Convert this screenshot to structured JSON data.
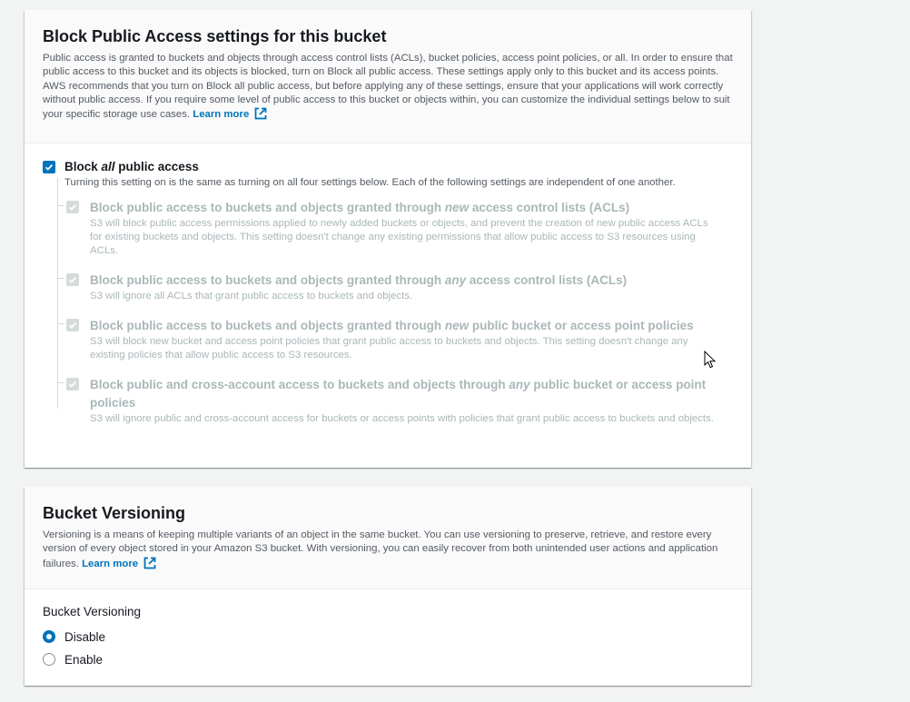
{
  "block_public_access": {
    "title": "Block Public Access settings for this bucket",
    "description": "Public access is granted to buckets and objects through access control lists (ACLs), bucket policies, access point policies, or all. In order to ensure that public access to this bucket and its objects is blocked, turn on Block all public access. These settings apply only to this bucket and its access points. AWS recommends that you turn on Block all public access, but before applying any of these settings, ensure that your applications will work correctly without public access. If you require some level of public access to this bucket or objects within, you can customize the individual settings below to suit your specific storage use cases.",
    "learn_more": "Learn more",
    "external_icon": "external-link-icon",
    "master": {
      "label_pre": "Block ",
      "label_em": "all",
      "label_post": " public access",
      "description": "Turning this setting on is the same as turning on all four settings below. Each of the following settings are independent of one another.",
      "checked": true
    },
    "settings": [
      {
        "label_pre": "Block public access to buckets and objects granted through ",
        "label_em": "new",
        "label_post": " access control lists (ACLs)",
        "description": "S3 will block public access permissions applied to newly added buckets or objects, and prevent the creation of new public access ACLs for existing buckets and objects. This setting doesn't change any existing permissions that allow public access to S3 resources using ACLs.",
        "checked": true,
        "disabled": true
      },
      {
        "label_pre": "Block public access to buckets and objects granted through ",
        "label_em": "any",
        "label_post": " access control lists (ACLs)",
        "description": "S3 will ignore all ACLs that grant public access to buckets and objects.",
        "checked": true,
        "disabled": true
      },
      {
        "label_pre": "Block public access to buckets and objects granted through ",
        "label_em": "new",
        "label_post": " public bucket or access point policies",
        "description": "S3 will block new bucket and access point policies that grant public access to buckets and objects. This setting doesn't change any existing policies that allow public access to S3 resources.",
        "checked": true,
        "disabled": true
      },
      {
        "label_pre": "Block public and cross-account access to buckets and objects through ",
        "label_em": "any",
        "label_post": " public bucket or access point policies",
        "description": "S3 will ignore public and cross-account access for buckets or access points with policies that grant public access to buckets and objects.",
        "checked": true,
        "disabled": true
      }
    ]
  },
  "bucket_versioning": {
    "title": "Bucket Versioning",
    "description": "Versioning is a means of keeping multiple variants of an object in the same bucket. You can use versioning to preserve, retrieve, and restore every version of every object stored in your Amazon S3 bucket. With versioning, you can easily recover from both unintended user actions and application failures.",
    "learn_more": "Learn more",
    "field_label": "Bucket Versioning",
    "options": [
      {
        "label": "Disable",
        "selected": true
      },
      {
        "label": "Enable",
        "selected": false
      }
    ]
  },
  "colors": {
    "accent": "#0073bb",
    "disabled_text": "#aab7b8",
    "disabled_box": "#d5dbdb",
    "muted_text": "#545b64",
    "page_bg": "#f2f3f3"
  },
  "cursor_icon": "mouse-pointer-icon"
}
